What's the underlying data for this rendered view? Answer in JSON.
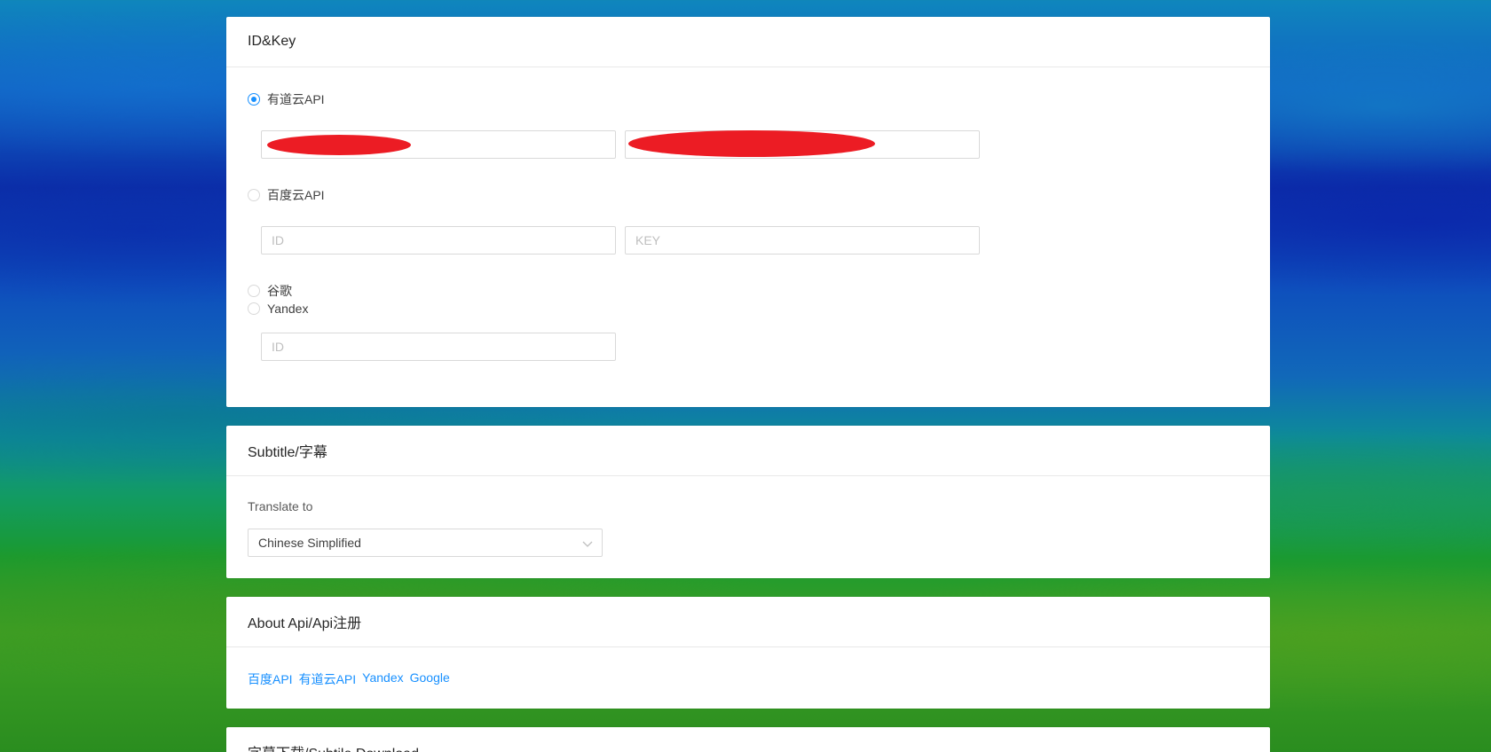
{
  "idkey_card": {
    "title": "ID&Key",
    "youdao": {
      "label": "有道云API",
      "selected": true
    },
    "baidu": {
      "label": "百度云API",
      "selected": false,
      "id_placeholder": "ID",
      "key_placeholder": "KEY"
    },
    "google": {
      "label": "谷歌",
      "selected": false
    },
    "yandex": {
      "label": "Yandex",
      "selected": false,
      "id_placeholder": "ID"
    }
  },
  "subtitle_card": {
    "title": "Subtitle/字幕",
    "translate_label": "Translate to",
    "translate_value": "Chinese Simplified"
  },
  "about_card": {
    "title": "About Api/Api注册",
    "links": [
      "百度API",
      "有道云API",
      "Yandex",
      "Google"
    ]
  },
  "download_card": {
    "title": "字幕下载/Subtile Download"
  },
  "colors": {
    "accent": "#1890ff",
    "redaction": "#ec1c24"
  }
}
